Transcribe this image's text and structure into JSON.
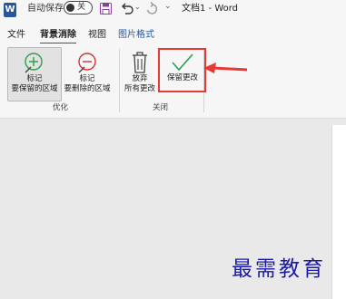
{
  "titlebar": {
    "app_icon": "W",
    "autosave_label": "自动保存",
    "autosave_state": "关",
    "qat_more": "⌄",
    "undo_dropdown": "⌄",
    "document_title": "文档1 - Word"
  },
  "tabs": [
    {
      "label": "文件"
    },
    {
      "label": "背景消除"
    },
    {
      "label": "视图"
    },
    {
      "label": "图片格式"
    }
  ],
  "ribbon": {
    "groups": [
      {
        "label": "优化",
        "buttons": [
          {
            "line1": "标记",
            "line2": "要保留的区域",
            "icon": "pencil-plus-icon",
            "icon_color": "#2e9e4b"
          },
          {
            "line1": "标记",
            "line2": "要删除的区域",
            "icon": "pencil-minus-icon",
            "icon_color": "#d13438"
          }
        ]
      },
      {
        "label": "关闭",
        "buttons": [
          {
            "line1": "放弃",
            "line2": "所有更改",
            "icon": "trash-icon"
          },
          {
            "line1": "保留更改",
            "icon": "checkmark-icon",
            "icon_color": "#2e9e4b"
          }
        ]
      }
    ]
  },
  "annotation": {
    "highlight_color": "#e53935"
  },
  "watermark": "最需教育"
}
